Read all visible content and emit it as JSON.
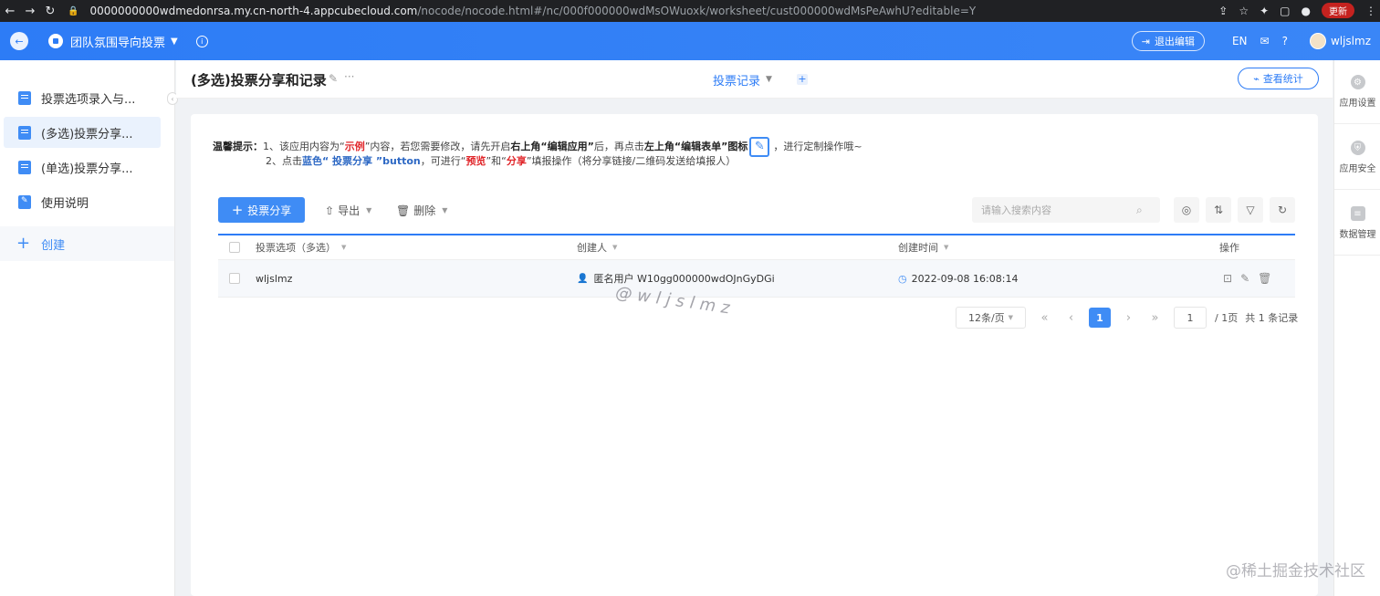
{
  "browser": {
    "url_host": "0000000000wdmedonrsa.my.cn-north-4.appcubecloud.com",
    "url_path": "/nocode/nocode.html#/nc/000f000000wdMsOWuoxk/worksheet/cust000000wdMsPeAwhU?editable=Y",
    "update_label": "更新"
  },
  "header": {
    "app_name": "团队氛围导向投票",
    "exit_edit_label": "退出编辑",
    "lang": "EN",
    "user_name": "wljslmz"
  },
  "sidebar": {
    "items": [
      {
        "label": "投票选项录入与..."
      },
      {
        "label": "(多选)投票分享..."
      },
      {
        "label": "(单选)投票分享..."
      },
      {
        "label": "使用说明"
      }
    ],
    "create_label": "创建"
  },
  "titlebar": {
    "title": "(多选)投票分享和记录",
    "more": "···",
    "view_tab": "投票记录",
    "stats_label": "查看统计"
  },
  "right_rail": {
    "items": [
      {
        "label": "应用设置"
      },
      {
        "label": "应用安全"
      },
      {
        "label": "数据管理"
      }
    ]
  },
  "tip": {
    "prefix": "温馨提示：",
    "l1_a": "1、该应用内容为“",
    "l1_b": "示例",
    "l1_c": "”内容，若您需要修改，请先开启",
    "l1_d": "右上角“编辑应用”",
    "l1_e": "后，再点击",
    "l1_f": "左上角“编辑表单”图标",
    "l1_g": "，进行定制操作哦~",
    "l2_a": "2、点击",
    "l2_b": "蓝色“ 投票分享 ”button",
    "l2_c": "，可进行“",
    "l2_d": "预览",
    "l2_e": "”和“",
    "l2_f": "分享",
    "l2_g": "”填报操作（将分享链接/二维码发送给填报人）"
  },
  "toolbar": {
    "add_label": "投票分享",
    "export_label": "导出",
    "delete_label": "删除",
    "search_placeholder": "请输入搜索内容"
  },
  "table": {
    "columns": [
      "投票选项（多选）",
      "创建人",
      "创建时间",
      "操作"
    ],
    "rows": [
      {
        "option": "wljslmz",
        "creator": "匿名用户 W10gg000000wdOJnGyDGi",
        "time": "2022-09-08 16:08:14"
      }
    ]
  },
  "pager": {
    "page_size": "12条/页",
    "current": "1",
    "jump_value": "1",
    "total_pages": "/ 1页",
    "total_records": "共 1 条记录"
  },
  "watermark": "@wljslmz",
  "corner_mark": "@稀土掘金技术社区",
  "colors": {
    "accent": "#2d7cf6",
    "header_bg": "#2d7cf6",
    "tip_red": "#e0262a",
    "tip_blue": "#2d68c4"
  }
}
